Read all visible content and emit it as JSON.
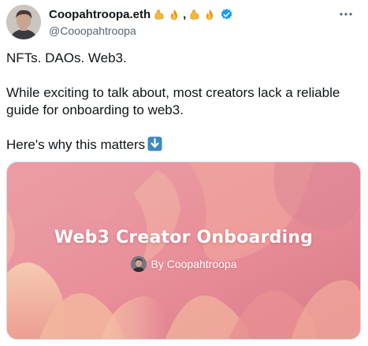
{
  "author": {
    "display_name": "Coopahtroopa.eth",
    "comma": ",",
    "handle": "@Cooopahtroopa",
    "icons": [
      "flexed-biceps-emoji",
      "fire-emoji",
      "flexed-biceps-emoji",
      "fire-emoji",
      "verified-badge-icon",
      "more-options-icon"
    ]
  },
  "tweet": {
    "line1": "NFTs. DAOs. Web3.",
    "line2": "While exciting to talk about, most creators lack a reliable guide for onboarding to web3.",
    "line3": "Here's why this matters"
  },
  "card": {
    "title": "Web3 Creator Onboarding",
    "byline": "By Coopahtroopa"
  },
  "colors": {
    "verified": "#1d9bf0",
    "handle": "#536471",
    "card_pink": "#e78a97",
    "card_peach": "#f2b89a"
  }
}
